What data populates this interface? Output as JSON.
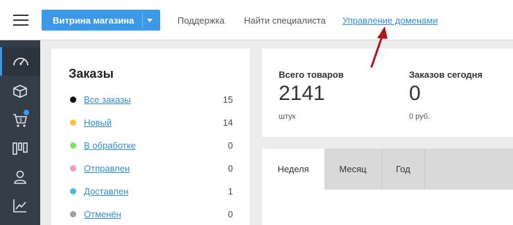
{
  "header": {
    "store_button": "Витрина магазина",
    "links": [
      "Поддержка",
      "Найти специалиста",
      "Управление доменами"
    ]
  },
  "sidebar": {
    "items": [
      {
        "icon": "dashboard-icon"
      },
      {
        "icon": "box-icon"
      },
      {
        "icon": "cart-icon"
      },
      {
        "icon": "columns-icon"
      },
      {
        "icon": "user-icon"
      },
      {
        "icon": "chart-icon"
      }
    ]
  },
  "orders": {
    "title": "Заказы",
    "rows": [
      {
        "label": "Все заказы",
        "count": "15",
        "color": "#111111"
      },
      {
        "label": "Новый",
        "count": "14",
        "color": "#f5c242"
      },
      {
        "label": "В обработке",
        "count": "0",
        "color": "#7ee26a"
      },
      {
        "label": "Отправлен",
        "count": "0",
        "color": "#f29bb7"
      },
      {
        "label": "Доставлен",
        "count": "1",
        "color": "#4db6e8"
      },
      {
        "label": "Отменён",
        "count": "0",
        "color": "#9e9e9e"
      }
    ]
  },
  "stats": {
    "total_products": {
      "title": "Всего товаров",
      "value": "2141",
      "unit": "штук"
    },
    "orders_today": {
      "title": "Заказов сегодня",
      "value": "0",
      "unit": "0 руб."
    }
  },
  "period_tabs": [
    "Неделя",
    "Месяц",
    "Год"
  ],
  "colors": {
    "accent": "#3b99e8",
    "sidebar": "#343e48",
    "annotation_arrow": "#b0151b"
  }
}
